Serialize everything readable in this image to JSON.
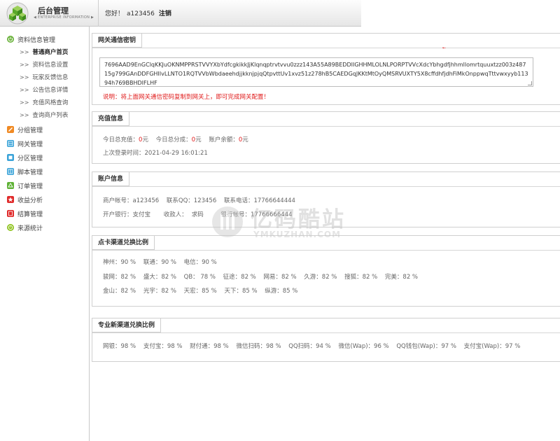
{
  "header": {
    "title": "后台管理",
    "subtitle": "◀ ENTERPRISE INFORMATION ▶",
    "greeting": "您好！",
    "username": "a123456",
    "logout": "注销"
  },
  "sidebar": {
    "groups": [
      {
        "label": "资料信息管理",
        "icon": "power-icon",
        "color": "#6cb33e"
      },
      {
        "label": "分组管理",
        "icon": "pencil-icon",
        "color": "#f08a24"
      },
      {
        "label": "网关管理",
        "icon": "grid-icon",
        "color": "#3aa3d8"
      },
      {
        "label": "分区管理",
        "icon": "puzzle-icon",
        "color": "#3aa3d8"
      },
      {
        "label": "脚本管理",
        "icon": "grid-icon",
        "color": "#3aa3d8"
      },
      {
        "label": "订单管理",
        "icon": "recycle-icon",
        "color": "#5fb236"
      },
      {
        "label": "收益分析",
        "icon": "star-icon",
        "color": "#e02b2b"
      },
      {
        "label": "结算管理",
        "icon": "calculator-icon",
        "color": "#e02b2b"
      },
      {
        "label": "来源统计",
        "icon": "clock-icon",
        "color": "#8fc31f"
      }
    ],
    "sub_items": [
      {
        "label": "普通商户首页",
        "active": true
      },
      {
        "label": "资料信息设置"
      },
      {
        "label": "玩家反馈信息"
      },
      {
        "label": "公告信息详情"
      },
      {
        "label": "充值风格查询"
      },
      {
        "label": "查询商户列表"
      }
    ],
    "arrow": ">>"
  },
  "gateway": {
    "title": "网关通信密钥",
    "key": "7696AAD9EnGClqKKJuOKNMPPRSTVVYXbYdfcgkikkJjKlqnqptrvtvvu0zzz143A55A89BEDDIIGHHMLOLNLPORPTVVcXdcYbhgdfjhhmllomrtquuxtzz003z48715g799GAnDDFGHIIvLLNTO1RQTVVbWbdaeehdjjkknjpjqQtpvttUv1xvz51z278hB5CAEDGqJKKtMtOyQMSRVUXTY5X8cffdhfjdhFiMkOnppwqTttvwxyyb11394h769BBHDIFLHF",
    "note": "说明：将上面网关通信密码复制到网关上，即可完成网关配置！",
    "marker": "←"
  },
  "recharge": {
    "title": "充值信息",
    "today_recharge_label": "今日总充值：",
    "today_recharge_value": "0",
    "today_share_label": "今日总分成：",
    "today_share_value": "0",
    "balance_label": "账户余额：",
    "balance_value": "0",
    "unit": "元",
    "last_login_label": "上次登录时间：",
    "last_login_value": "2021-04-29 16:01:21"
  },
  "account": {
    "title": "账户信息",
    "merchant_label": "商户帐号：",
    "merchant_value": "a123456",
    "qq_label": "联系QQ：",
    "qq_value": "123456",
    "phone_label": "联系电话：",
    "phone_value": "17766644444",
    "bank_label": "开户银行：",
    "bank_value": "支付宝",
    "payee_label": "收款人：",
    "payee_value": "求码",
    "bank_account_label": "银行帐号：",
    "bank_account_value": "17766666444"
  },
  "card_rates": {
    "title": "点卡渠道兑换比例",
    "rows": [
      [
        "神州：90 %",
        "联通：90 %",
        "电信：90 %"
      ],
      [
        "骏网：82 %",
        "盛大：82 %",
        "QB： 78 %",
        "征途：82 %",
        "网易：82 %",
        "久游：82 %",
        "搜狐：82 %",
        "完美：82 %"
      ],
      [
        "金山：82 %",
        "光宇：82 %",
        "天宏：85 %",
        "天下：85 %",
        "纵游：85 %"
      ]
    ]
  },
  "new_rates": {
    "title": "专业新渠道兑换比例",
    "rows": [
      [
        "网银：98 %",
        "支付宝：98 %",
        "财付通：98 %",
        "微信扫码：98 %",
        "QQ扫码：94 %",
        "微信(Wap)：96 %",
        "QQ钱包(Wap)：97 %",
        "支付宝(Wap)：97 %"
      ]
    ]
  },
  "watermark": {
    "text": "亿码酷站",
    "sub": "YMKUZHAN.COM"
  }
}
